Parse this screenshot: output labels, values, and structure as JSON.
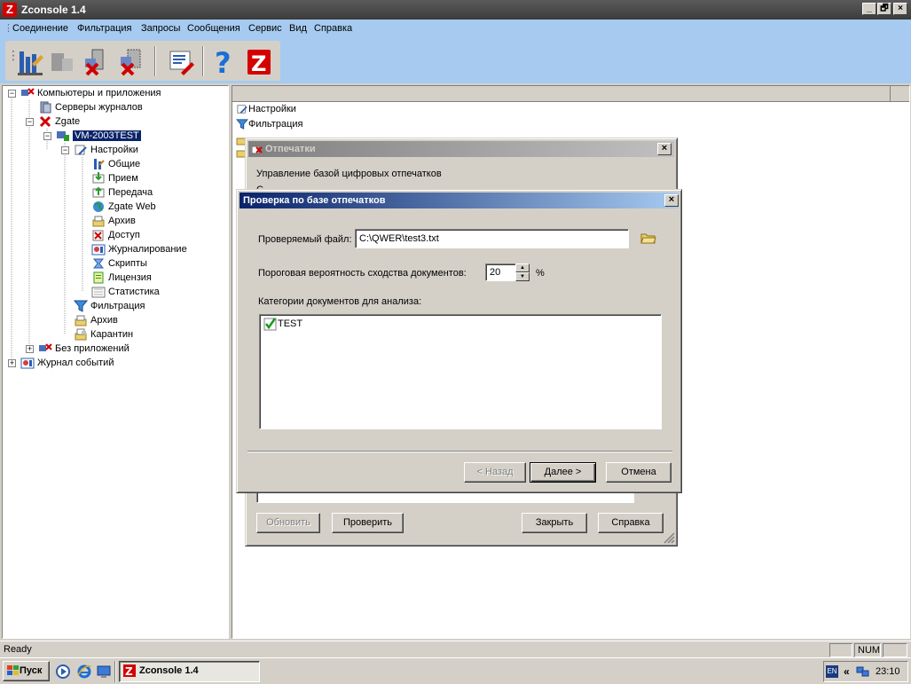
{
  "window": {
    "title": "Zconsole 1.4",
    "app_icon_letter": "Z",
    "min": "_",
    "restore": "🗗",
    "close": "×"
  },
  "menu": [
    "Соединение",
    "Фильтрация",
    "Запросы",
    "Сообщения",
    "Сервис",
    "Вид",
    "Справка"
  ],
  "tree": {
    "root": "Компьютеры и приложения",
    "servers": "Серверы журналов",
    "zgate": "Zgate",
    "host": "VM-2003TEST",
    "settings": "Настройки",
    "settings_items": [
      "Общие",
      "Прием",
      "Передача",
      "Zgate Web",
      "Архив",
      "Доступ",
      "Журналирование",
      "Скрипты",
      "Лицензия",
      "Статистика"
    ],
    "filtering": "Фильтрация",
    "archive": "Архив",
    "quarantine": "Карантин",
    "no_apps": "Без приложений",
    "events": "Журнал событий"
  },
  "right_pane": {
    "items": [
      "Настройки",
      "Фильтрация"
    ]
  },
  "dialog_back": {
    "title": "Отпечатки",
    "description": "Управление базой цифровых отпечатков",
    "truncated": "С",
    "buttons": {
      "refresh": "Обновить",
      "check": "Проверить",
      "close": "Закрыть",
      "help": "Справка"
    }
  },
  "dialog_front": {
    "title": "Проверка по базе отпечатков",
    "file_label": "Проверяемый файл:",
    "file_value": "C:\\QWER\\test3.txt",
    "threshold_label": "Пороговая вероятность сходства документов:",
    "threshold_value": "20",
    "percent": "%",
    "categories_label": "Категории документов для анализа:",
    "categories": [
      {
        "name": "TEST",
        "checked": true
      }
    ],
    "buttons": {
      "back": "< Назад",
      "next": "Далее >",
      "cancel": "Отмена"
    }
  },
  "status": {
    "text": "Ready",
    "num": "NUM"
  },
  "taskbar": {
    "start": "Пуск",
    "task": "Zconsole 1.4",
    "lang": "EN",
    "chevron": "«",
    "clock": "23:10"
  }
}
